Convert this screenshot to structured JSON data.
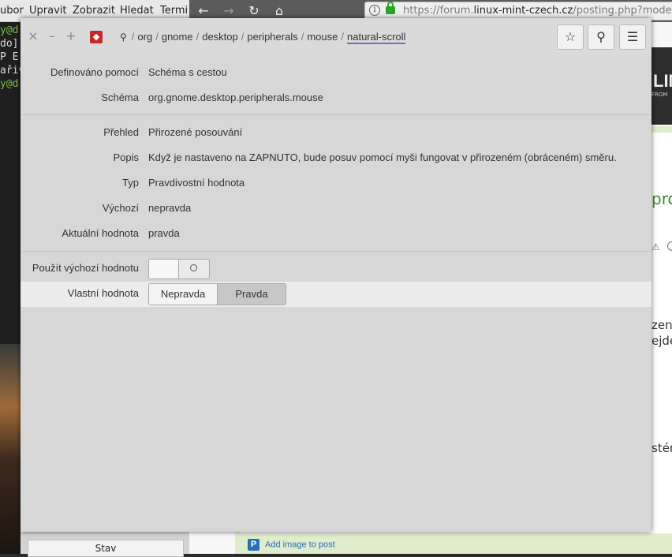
{
  "terminal": {
    "menu": [
      "ubor",
      "Upravit",
      "Zobrazit",
      "Hledat",
      "Termi"
    ],
    "lines": [
      "y@d",
      "do]",
      "P E",
      "ařiv",
      "y@d"
    ]
  },
  "browser": {
    "url_prefix": "https://forum.",
    "url_domain": "linux-mint-czech.cz",
    "url_path": "/posting.php?mode=post&f=",
    "banner_text": "LIN",
    "banner_sub": "FROM",
    "fragments": [
      "pro",
      "zený",
      "ejde",
      "stém"
    ],
    "add_image": "Add image to post",
    "bottom_button": "Stav"
  },
  "dialog": {
    "path": [
      "org",
      "gnome",
      "desktop",
      "peripherals",
      "mouse",
      "natural-scroll"
    ],
    "fields": {
      "defined_by_label": "Definováno pomocí",
      "defined_by_value": "Schéma s cestou",
      "schema_label": "Schéma",
      "schema_value": "org.gnome.desktop.peripherals.mouse",
      "summary_label": "Přehled",
      "summary_value": "Přirozené posouvání",
      "description_label": "Popis",
      "description_value": "Když je nastaveno na ZAPNUTO, bude posuv pomocí myši fungovat v přirozeném (obráceném) směru.",
      "type_label": "Typ",
      "type_value": "Pravdivostní hodnota",
      "default_label": "Výchozí",
      "default_value": "nepravda",
      "current_label": "Aktuální hodnota",
      "current_value": "pravda",
      "use_default_label": "Použít výchozí hodnotu",
      "custom_label": "Vlastní hodnota",
      "custom_false": "Nepravda",
      "custom_true": "Pravda"
    },
    "use_default_enabled": false,
    "selected_custom": "Pravda"
  },
  "colors": {
    "accent": "#7a68c2",
    "app_icon": "#c62828",
    "site_green": "#3c8b2d"
  }
}
